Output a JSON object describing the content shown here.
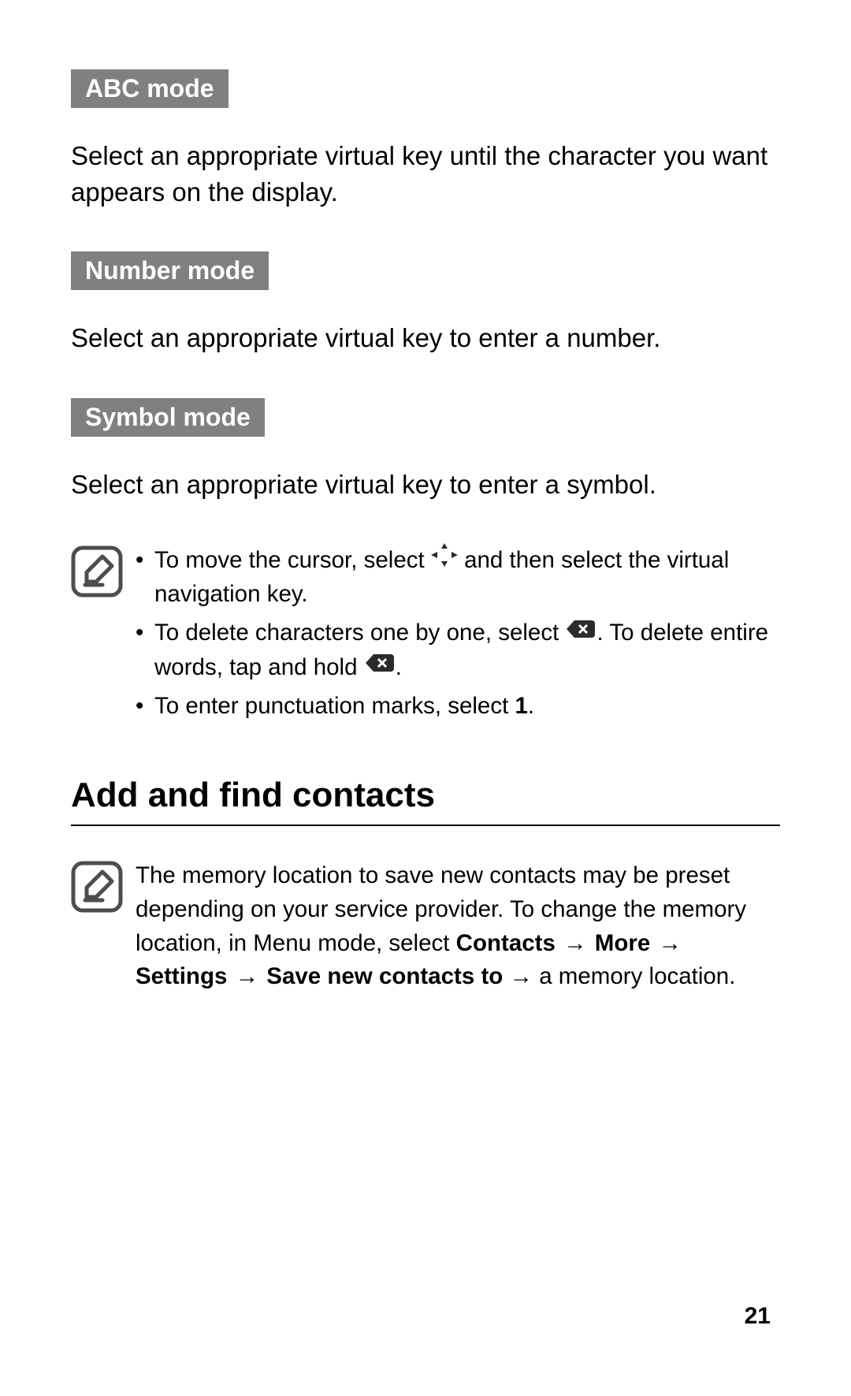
{
  "sections": {
    "abc": {
      "label": "ABC mode",
      "body": "Select an appropriate virtual key until the character you want appears on the display."
    },
    "number": {
      "label": "Number mode",
      "body": "Select an appropriate virtual key to enter a number."
    },
    "symbol": {
      "label": "Symbol mode",
      "body": "Select an appropriate virtual key to enter a symbol."
    }
  },
  "tips": {
    "cursor_a": "To move the cursor, select ",
    "cursor_b": " and then select the virtual navigation key.",
    "delete_a": "To delete characters one by one, select ",
    "delete_b": ". To delete entire words, tap and hold ",
    "delete_c": ".",
    "punct_a": "To enter punctuation marks, select ",
    "punct_key": "1",
    "punct_b": "."
  },
  "heading": "Add and find contacts",
  "memo": {
    "intro": "The memory location to save new contacts may be preset depending on your service provider. To change the memory location, in Menu mode, select ",
    "path1": "Contacts",
    "path2": "More",
    "path3": "Settings",
    "path4": "Save new contacts to",
    "tail": " → a memory location."
  },
  "arrow": "→",
  "pageNumber": "21"
}
